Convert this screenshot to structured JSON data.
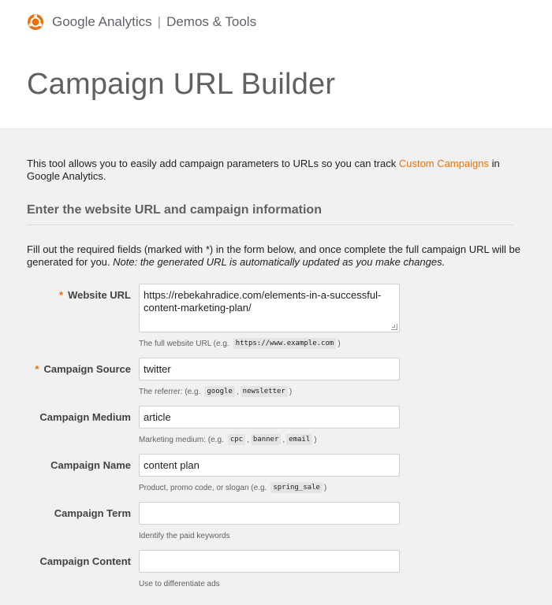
{
  "brand": {
    "google": "Google Analytics",
    "separator": "|",
    "section": "Demos & Tools"
  },
  "page_title": "Campaign URL Builder",
  "intro": {
    "before_link": "This tool allows you to easily add campaign parameters to URLs so you can track ",
    "link": "Custom Campaigns",
    "after_link": " in Google Analytics."
  },
  "section_title": "Enter the website URL and campaign information",
  "instructions": {
    "text": "Fill out the required fields (marked with *) in the form below, and once complete the full campaign URL will be generated for you. ",
    "note": "Note: the generated URL is automatically updated as you make changes."
  },
  "required_mark": "*",
  "fields": {
    "website_url": {
      "label": "Website URL",
      "value": "https://rebekahradice.com/elements-in-a-successful-content-marketing-plan/",
      "hint_before": "The full website URL (e.g.",
      "hint_code": "https://www.example.com",
      "hint_after": ")"
    },
    "campaign_source": {
      "label": "Campaign Source",
      "value": "twitter",
      "hint_before": "The referrer: (e.g.",
      "hint_code_1": "google",
      "hint_sep": ",",
      "hint_code_2": "newsletter",
      "hint_after": ")"
    },
    "campaign_medium": {
      "label": "Campaign Medium",
      "value": "article",
      "hint_before": "Marketing medium: (e.g.",
      "hint_code_1": "cpc",
      "hint_sep_1": ",",
      "hint_code_2": "banner",
      "hint_sep_2": ",",
      "hint_code_3": "email",
      "hint_after": ")"
    },
    "campaign_name": {
      "label": "Campaign Name",
      "value": "content plan",
      "hint_before": "Product, promo code, or slogan (e.g.",
      "hint_code": "spring_sale",
      "hint_after": ")"
    },
    "campaign_term": {
      "label": "Campaign Term",
      "value": "",
      "hint": "Identify the paid keywords"
    },
    "campaign_content": {
      "label": "Campaign Content",
      "value": "",
      "hint": "Use to differentiate ads"
    }
  }
}
